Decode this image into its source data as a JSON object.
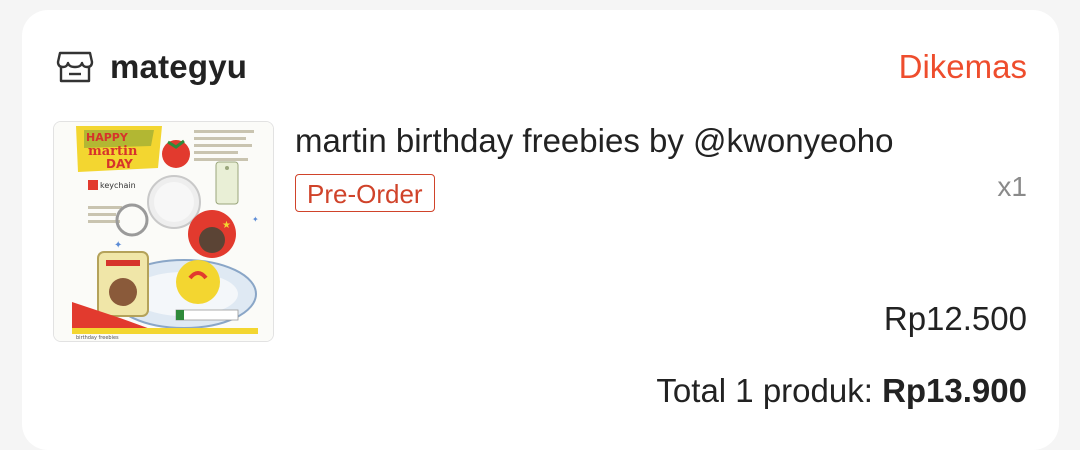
{
  "shop": {
    "icon": "store-icon",
    "name": "mategyu",
    "status": "Dikemas"
  },
  "product": {
    "title": "martin birthday freebies by @kwonyeoho",
    "badge": "Pre-Order",
    "quantity": "x1",
    "price": "Rp12.500",
    "image": {
      "headline_lines": [
        "HAPPY",
        "martin",
        "DAY"
      ],
      "tag": "keychain",
      "footer_text": "birthday freebies"
    }
  },
  "summary": {
    "label": "Total 1 produk: ",
    "amount": "Rp13.900"
  },
  "colors": {
    "accent": "#ee4d2d",
    "badge": "#d0432a",
    "text": "#222222",
    "muted": "#8a8a8a"
  }
}
